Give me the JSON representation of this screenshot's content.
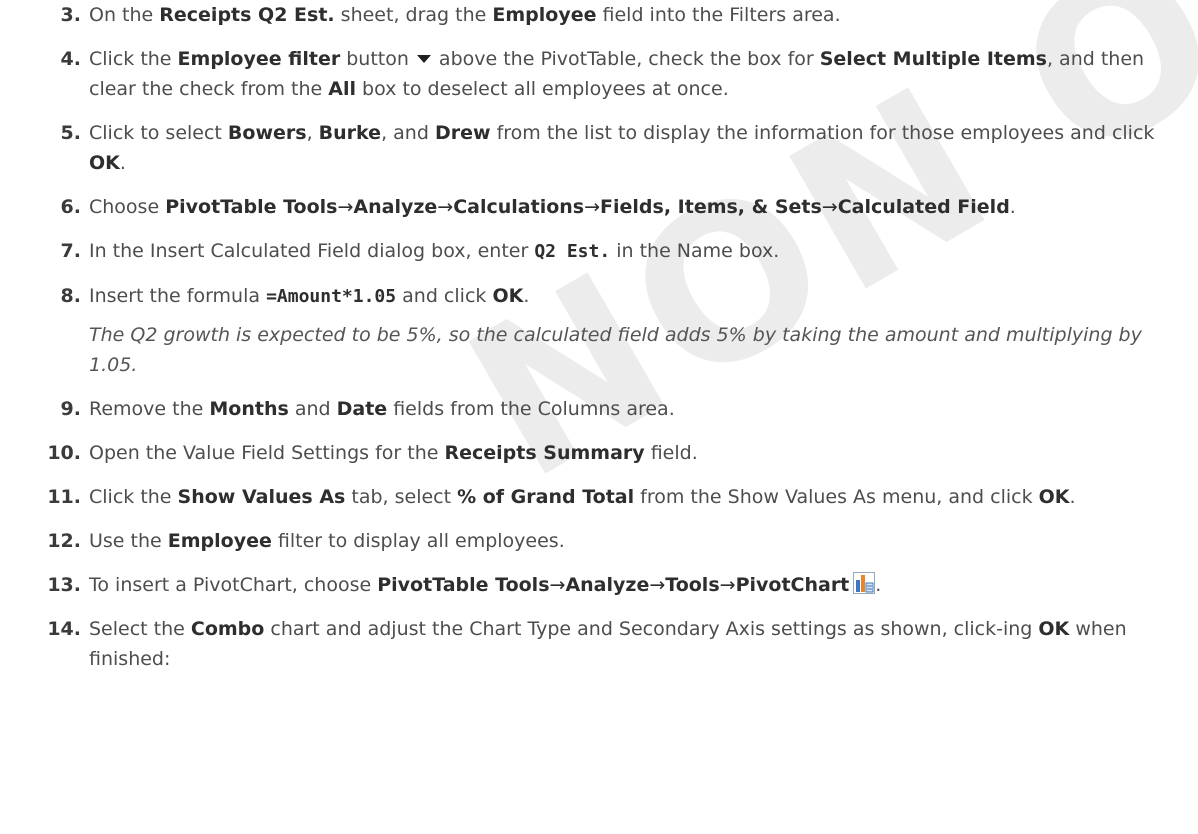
{
  "watermark": "NON ONLY",
  "steps": [
    {
      "num": "3.",
      "parts": [
        "On the ",
        "Receipts Q2 Est.",
        " sheet, drag the ",
        "Employee",
        " field into the Filters area."
      ]
    },
    {
      "num": "4.",
      "parts": [
        "Click the ",
        "Employee filter",
        " button",
        "above the PivotTable, check the box for ",
        "Select Multiple Items",
        ", and then clear the check from the ",
        "All",
        " box to deselect all employees at once."
      ]
    },
    {
      "num": "5.",
      "parts": [
        "Click to select ",
        "Bowers",
        ", ",
        "Burke",
        ", and ",
        "Drew",
        " from the list to display the information for those employees and click ",
        "OK",
        "."
      ]
    },
    {
      "num": "6.",
      "parts": [
        "Choose ",
        "PivotTable Tools",
        "→",
        "Analyze",
        "→",
        "Calculations",
        "→",
        "Fields, Items, & Sets",
        "→",
        "Calculated Field",
        "."
      ]
    },
    {
      "num": "7.",
      "parts": [
        "In the Insert Calculated Field dialog box, enter ",
        "Q2 Est.",
        " in the Name box."
      ]
    },
    {
      "num": "8.",
      "parts": [
        "Insert the formula ",
        "=Amount*1.05",
        " and click ",
        "OK",
        "."
      ]
    },
    {
      "num": "9.",
      "parts": [
        "Remove the ",
        "Months",
        " and ",
        "Date",
        " fields from the Columns area."
      ]
    },
    {
      "num": "10.",
      "parts": [
        "Open the Value Field Settings for the ",
        "Receipts Summary",
        " field."
      ]
    },
    {
      "num": "11.",
      "parts": [
        "Click the ",
        "Show Values As",
        " tab, select ",
        "% of Grand Total",
        " from the Show Values As menu, and click ",
        "OK",
        "."
      ]
    },
    {
      "num": "12.",
      "parts": [
        "Use the ",
        "Employee",
        " filter to display all employees."
      ]
    },
    {
      "num": "13.",
      "parts": [
        "To insert a PivotChart, choose ",
        "PivotTable Tools",
        "→",
        "Analyze",
        "→",
        "Tools",
        "→",
        "PivotChart",
        "."
      ]
    },
    {
      "num": "14.",
      "parts": [
        "Select the ",
        "Combo",
        " chart and adjust the Chart Type and Secondary Axis settings as shown, click-ing ",
        "OK",
        " when finished:"
      ]
    }
  ],
  "note": "The Q2 growth is expected to be 5%, so the calculated field adds 5% by taking the amount and multiplying by 1.05.",
  "icons": {
    "dropdown": "dropdown-arrow-icon",
    "pivotchart": "pivotchart-icon"
  }
}
